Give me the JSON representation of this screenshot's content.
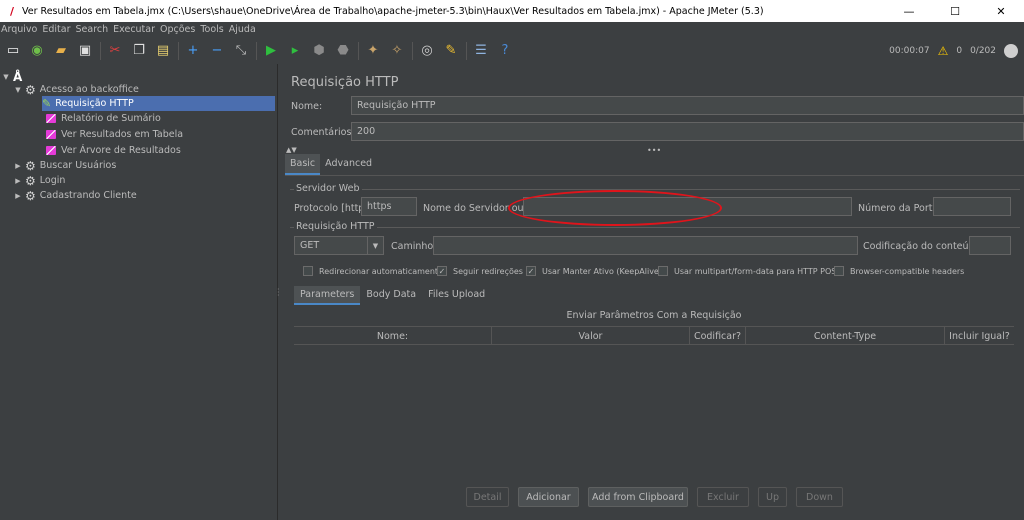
{
  "window": {
    "title": "Ver Resultados em Tabela.jmx (C:\\Users\\shaue\\OneDrive\\Área de Trabalho\\apache-jmeter-5.3\\bin\\Haux\\Ver Resultados em Tabela.jmx) - Apache JMeter (5.3)",
    "minimize": "—",
    "maximize": "☐",
    "close": "✕"
  },
  "menu": [
    "Arquivo",
    "Editar",
    "Search",
    "Executar",
    "Opções",
    "Tools",
    "Ajuda"
  ],
  "toolbar": {
    "timer": "00:00:07",
    "warnings": "0",
    "threads": "0/202"
  },
  "tree": {
    "root": "",
    "nodes": [
      {
        "label": "Acesso ao backoffice"
      },
      {
        "label": "Requisição HTTP"
      },
      {
        "label": "Relatório de Sumário"
      },
      {
        "label": "Ver Resultados em Tabela"
      },
      {
        "label": "Ver Árvore de Resultados"
      },
      {
        "label": "Buscar Usuários"
      },
      {
        "label": "Login"
      },
      {
        "label": "Cadastrando Cliente"
      }
    ]
  },
  "panel": {
    "title": "Requisição HTTP",
    "name_label": "Nome:",
    "name_value": "Requisição HTTP",
    "comments_label": "Comentários:",
    "comments_value": "200",
    "tabs": [
      "Basic",
      "Advanced"
    ],
    "server_group": "Servidor Web",
    "protocol_label": "Protocolo [http]:",
    "protocol_value": "https",
    "server_label": "Nome do Servidor ou IP:",
    "server_value": "",
    "port_label": "Número da Porta:",
    "port_value": "",
    "request_group": "Requisição HTTP",
    "method_value": "GET",
    "path_label": "Caminho:",
    "path_value": "",
    "encoding_label": "Codificação do conteúdo:",
    "encoding_value": "",
    "checkboxes": [
      {
        "label": "Redirecionar automaticamente",
        "checked": false
      },
      {
        "label": "Seguir redireções",
        "checked": true
      },
      {
        "label": "Usar Manter Ativo (KeepAlive)",
        "checked": true
      },
      {
        "label": "Usar multipart/form-data para HTTP POST",
        "checked": false
      },
      {
        "label": "Browser-compatible headers",
        "checked": false
      }
    ],
    "subtabs": [
      "Parameters",
      "Body Data",
      "Files Upload"
    ],
    "table_caption": "Enviar Parâmetros Com a Requisição",
    "columns": [
      "Nome:",
      "Valor",
      "Codificar?",
      "Content-Type",
      "Incluir Igual?"
    ],
    "buttons": {
      "detail": "Detail",
      "add": "Adicionar",
      "clipboard": "Add from Clipboard",
      "delete": "Excluir",
      "up": "Up",
      "down": "Down"
    }
  },
  "colors": {
    "background": "#3c3f41",
    "selection": "#4b6eaf",
    "annotation": "#e0141b"
  }
}
